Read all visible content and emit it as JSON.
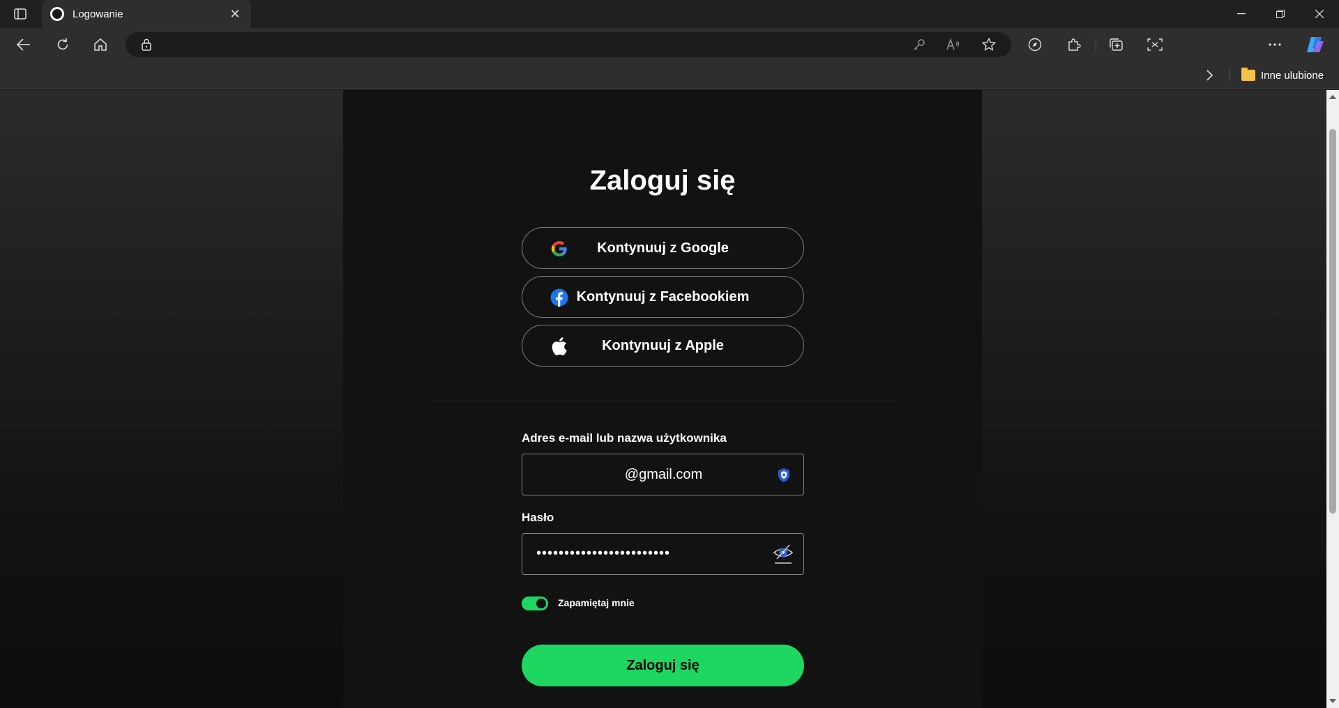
{
  "browser": {
    "tab_title": "Logowanie",
    "favorites_folder": "Inne ulubione"
  },
  "page": {
    "title": "Zaloguj się",
    "google_label": "Kontynuuj z Google",
    "facebook_label": "Kontynuuj z Facebookiem",
    "apple_label": "Kontynuuj z Apple",
    "email_label": "Adres e-mail lub nazwa użytkownika",
    "email_value": "@gmail.com",
    "password_label": "Hasło",
    "password_value": "••••••••••••••••••••••••",
    "remember_label": "Zapamiętaj mnie",
    "remember_checked": true,
    "login_label": "Zaloguj się"
  },
  "colors": {
    "accent": "#1ed760",
    "background": "#121212",
    "browser_chrome": "#2e2e2e"
  }
}
